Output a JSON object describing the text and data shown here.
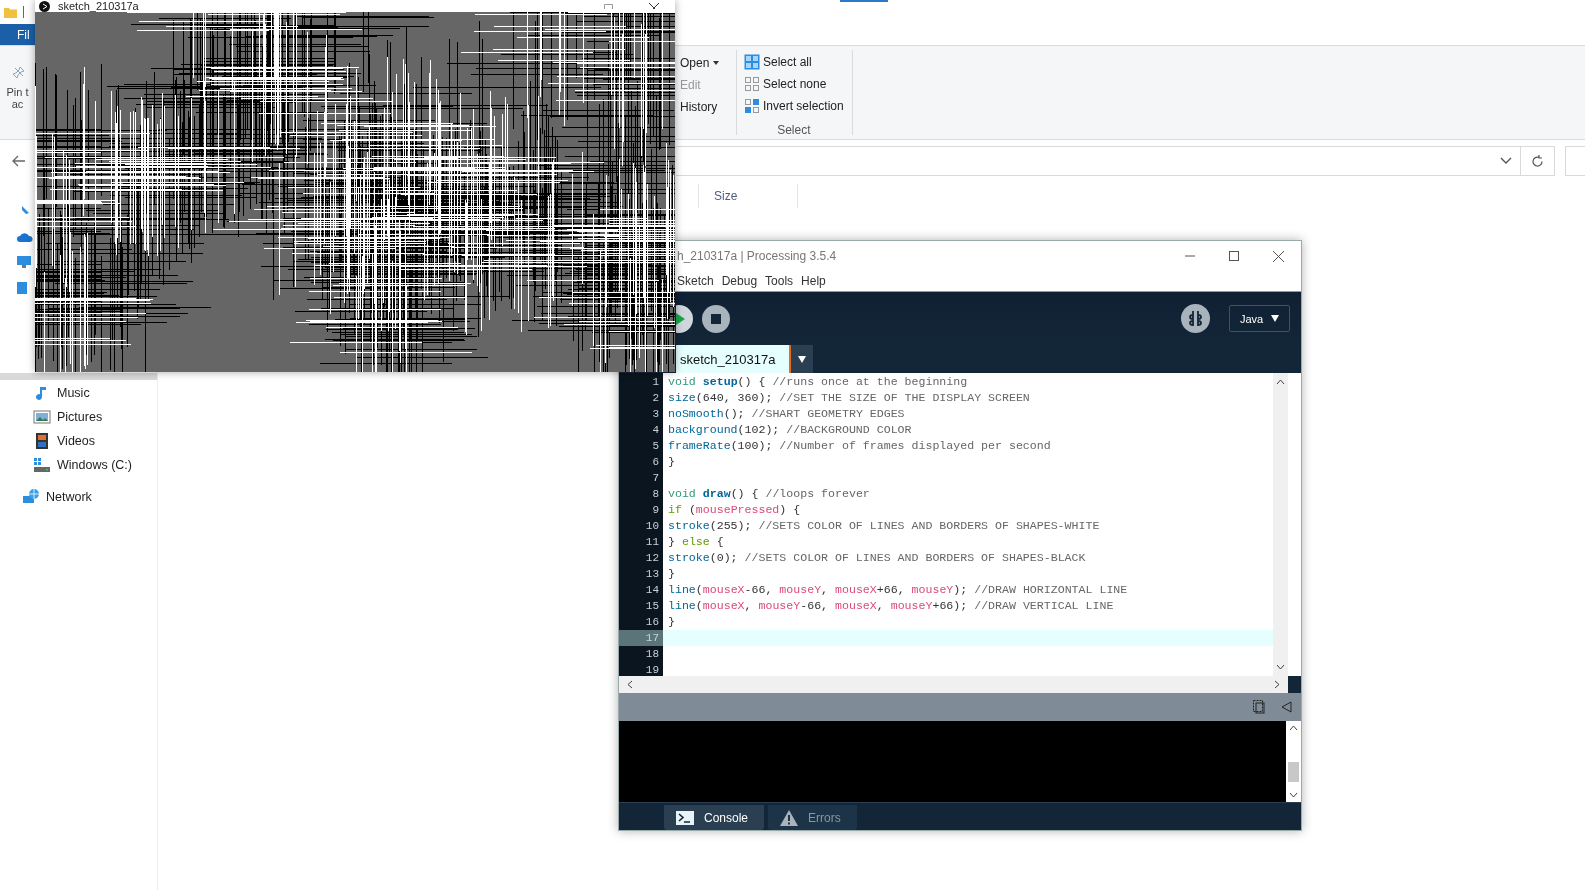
{
  "explorer": {
    "ribbon_tabs": [
      {
        "label": "Fil",
        "selected": true
      }
    ],
    "pin_button": {
      "label_lines": [
        "Pin t",
        "ac"
      ]
    },
    "open_items": [
      {
        "label": "Open",
        "disabled": false,
        "menu": true
      },
      {
        "label": "Edit",
        "disabled": true,
        "menu": false
      },
      {
        "label": "History",
        "disabled": false,
        "menu": false
      }
    ],
    "select_group": {
      "label": "Select",
      "items": [
        {
          "label": "Select all",
          "kind": "all"
        },
        {
          "label": "Select none",
          "kind": "none"
        },
        {
          "label": "Invert selection",
          "kind": "invert"
        }
      ]
    },
    "columns": [
      "Size"
    ],
    "sidebar": [
      {
        "label": "Music",
        "kind": "music"
      },
      {
        "label": "Pictures",
        "kind": "pictures"
      },
      {
        "label": "Videos",
        "kind": "videos"
      },
      {
        "label": "Windows (C:)",
        "kind": "drive"
      },
      {
        "label": "Network",
        "kind": "network"
      }
    ]
  },
  "sketch_window": {
    "title": "sketch_210317a"
  },
  "processing": {
    "title": "h_210317a | Processing 3.5.4",
    "menu": [
      "Sketch",
      "Debug",
      "Tools",
      "Help"
    ],
    "mode": "Java",
    "tabs": [
      {
        "label": "sketch_210317a",
        "selected": true
      }
    ],
    "code_lines": [
      {
        "number": "1",
        "current": false,
        "tokens": [
          {
            "text": "void ",
            "kind": "keyword"
          },
          {
            "text": "setup",
            "kind": "function_bold"
          },
          {
            "text": "() { ",
            "kind": "plain"
          },
          {
            "text": "//runs once at the beginning",
            "kind": "comment"
          }
        ]
      },
      {
        "number": "2",
        "current": false,
        "tokens": [
          {
            "text": "size",
            "kind": "function"
          },
          {
            "text": "(640, 360); ",
            "kind": "plain"
          },
          {
            "text": "//SET THE SIZE OF THE DISPLAY SCREEN",
            "kind": "comment"
          }
        ]
      },
      {
        "number": "3",
        "current": false,
        "tokens": [
          {
            "text": "noSmooth",
            "kind": "function"
          },
          {
            "text": "(); ",
            "kind": "plain"
          },
          {
            "text": "//SHART GEOMETRY EDGES",
            "kind": "comment"
          }
        ]
      },
      {
        "number": "4",
        "current": false,
        "tokens": [
          {
            "text": "background",
            "kind": "function"
          },
          {
            "text": "(102); ",
            "kind": "plain"
          },
          {
            "text": "//BACKGROUND COLOR",
            "kind": "comment"
          }
        ]
      },
      {
        "number": "5",
        "current": false,
        "tokens": [
          {
            "text": "frameRate",
            "kind": "function"
          },
          {
            "text": "(100); ",
            "kind": "plain"
          },
          {
            "text": "//Number of frames displayed per second",
            "kind": "comment"
          }
        ]
      },
      {
        "number": "6",
        "current": false,
        "tokens": [
          {
            "text": "}",
            "kind": "plain"
          }
        ]
      },
      {
        "number": "7",
        "current": false
      },
      {
        "number": "8",
        "current": false,
        "tokens": [
          {
            "text": "void ",
            "kind": "keyword"
          },
          {
            "text": "draw",
            "kind": "function_bold"
          },
          {
            "text": "() { ",
            "kind": "plain"
          },
          {
            "text": "//loops forever",
            "kind": "comment"
          }
        ]
      },
      {
        "number": "9",
        "current": false,
        "tokens": [
          {
            "text": "if",
            "kind": "control"
          },
          {
            "text": " (",
            "kind": "plain"
          },
          {
            "text": "mousePressed",
            "kind": "variable"
          },
          {
            "text": ") {",
            "kind": "plain"
          }
        ]
      },
      {
        "number": "10",
        "current": false,
        "tokens": [
          {
            "text": "stroke",
            "kind": "function"
          },
          {
            "text": "(255); ",
            "kind": "plain"
          },
          {
            "text": "//SETS COLOR OF LINES AND BORDERS OF SHAPES-WHITE",
            "kind": "comment"
          }
        ]
      },
      {
        "number": "11",
        "current": false,
        "tokens": [
          {
            "text": "} ",
            "kind": "plain"
          },
          {
            "text": "else",
            "kind": "control"
          },
          {
            "text": " {",
            "kind": "plain"
          }
        ]
      },
      {
        "number": "12",
        "current": false,
        "tokens": [
          {
            "text": "stroke",
            "kind": "function"
          },
          {
            "text": "(0); ",
            "kind": "plain"
          },
          {
            "text": "//SETS COLOR OF LINES AND BORDERS OF SHAPES-BLACK",
            "kind": "comment"
          }
        ]
      },
      {
        "number": "13",
        "current": false,
        "tokens": [
          {
            "text": "}",
            "kind": "plain"
          }
        ]
      },
      {
        "number": "14",
        "current": false,
        "tokens": [
          {
            "text": "line",
            "kind": "function"
          },
          {
            "text": "(",
            "kind": "plain"
          },
          {
            "text": "mouseX",
            "kind": "variable"
          },
          {
            "text": "-66, ",
            "kind": "plain"
          },
          {
            "text": "mouseY",
            "kind": "variable"
          },
          {
            "text": ", ",
            "kind": "plain"
          },
          {
            "text": "mouseX",
            "kind": "variable"
          },
          {
            "text": "+66, ",
            "kind": "plain"
          },
          {
            "text": "mouseY",
            "kind": "variable"
          },
          {
            "text": "); ",
            "kind": "plain"
          },
          {
            "text": "//DRAW HORIZONTAL LINE",
            "kind": "comment"
          }
        ]
      },
      {
        "number": "15",
        "current": false,
        "tokens": [
          {
            "text": "line",
            "kind": "function"
          },
          {
            "text": "(",
            "kind": "plain"
          },
          {
            "text": "mouseX",
            "kind": "variable"
          },
          {
            "text": ", ",
            "kind": "plain"
          },
          {
            "text": "mouseY",
            "kind": "variable"
          },
          {
            "text": "-66, ",
            "kind": "plain"
          },
          {
            "text": "mouseX",
            "kind": "variable"
          },
          {
            "text": ", ",
            "kind": "plain"
          },
          {
            "text": "mouseY",
            "kind": "variable"
          },
          {
            "text": "+66); ",
            "kind": "plain"
          },
          {
            "text": "//DRAW VERTICAL LINE",
            "kind": "comment"
          }
        ]
      },
      {
        "number": "16",
        "current": false,
        "tokens": [
          {
            "text": "}",
            "kind": "plain"
          }
        ]
      },
      {
        "number": "17",
        "current": true
      },
      {
        "number": "18",
        "current": false
      },
      {
        "number": "19",
        "current": false
      }
    ],
    "console_tabs": [
      {
        "label": "Console",
        "kind": "console",
        "selected": true
      },
      {
        "label": "Errors",
        "kind": "errors",
        "selected": false
      }
    ]
  }
}
